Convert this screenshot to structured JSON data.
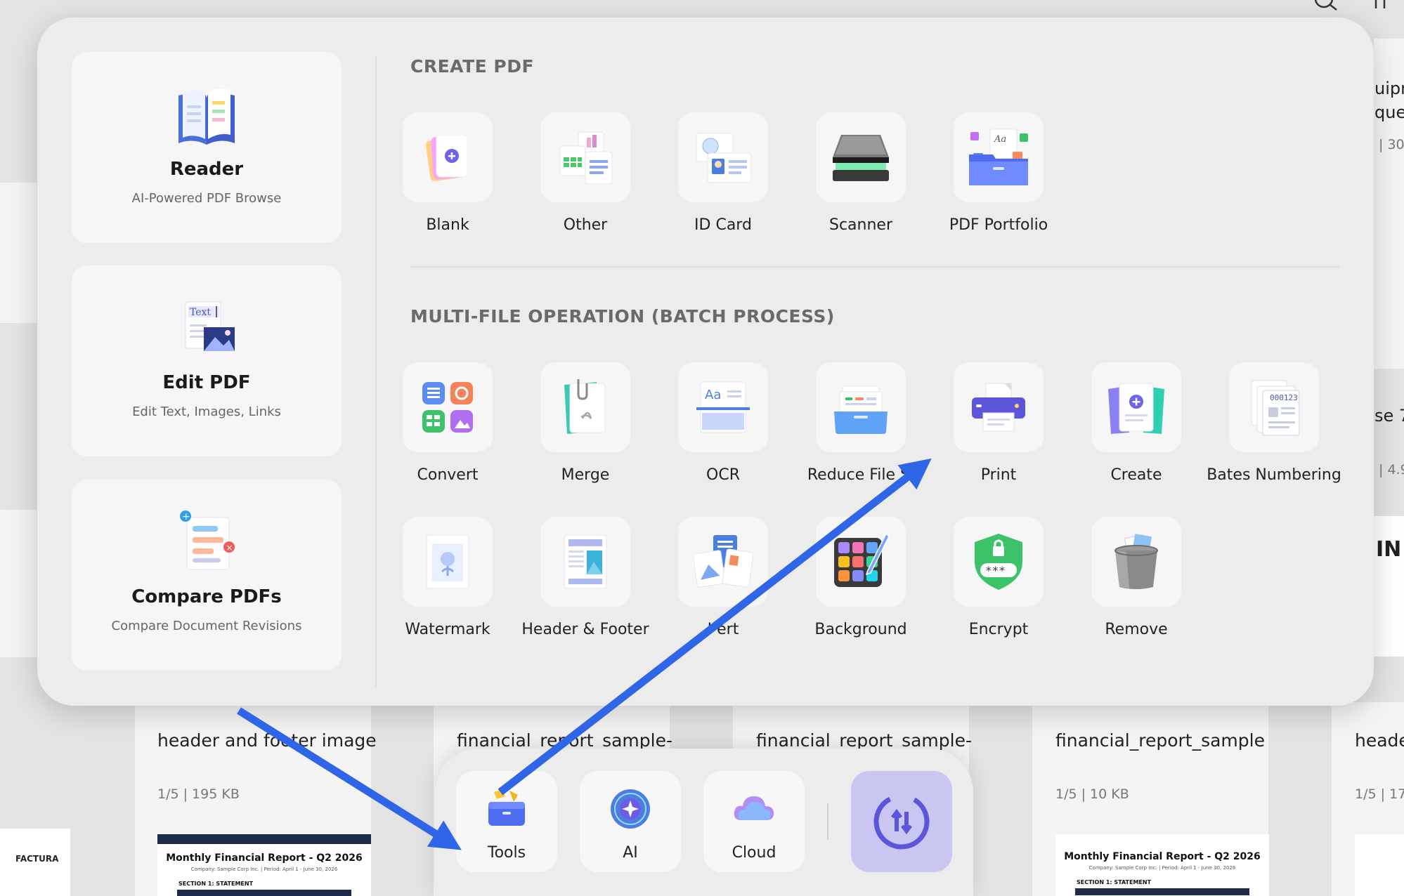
{
  "background_files": [
    {
      "title": "header and footer image",
      "meta": "1/5 | 195 KB",
      "thumb_title": "Monthly Financial Report - Q2 2026",
      "thumb_sub": "Company: Sample Corp Inc. | Period: April 1 - June 30, 2026",
      "thumb_section": "SECTION 1:  STATEMENT"
    },
    {
      "title": "financial_report_sample-",
      "meta": "",
      "thumb_title": "",
      "thumb_sub": "",
      "thumb_section": ""
    },
    {
      "title": "financial_report_sample-",
      "meta": "",
      "thumb_title": "",
      "thumb_sub": "",
      "thumb_section": ""
    },
    {
      "title": "financial_report_sample",
      "meta": "1/5 | 10 KB",
      "thumb_title": "Monthly Financial Report - Q2 2026",
      "thumb_sub": "Company: Sample Corp Inc. | Period: April 1 - June 30, 2026",
      "thumb_section": "SECTION 1:  STATEMENT"
    },
    {
      "title": "header",
      "meta": "1/5 | 17",
      "thumb_title": "",
      "thumb_sub": "",
      "thumb_section": ""
    }
  ],
  "edge_fragments": {
    "r1": "uipr",
    "r2": "que",
    "r3": "| 30",
    "r4": "se 7.",
    "r5": "| 4.9",
    "r6": "IN",
    "factura": "FACTURA"
  },
  "sidebar": [
    {
      "name": "Reader",
      "desc": "AI-Powered PDF Browse",
      "icon": "book-icon"
    },
    {
      "name": "Edit PDF",
      "desc": "Edit Text, Images, Links",
      "icon": "edit-text-image-icon"
    },
    {
      "name": "Compare PDFs",
      "desc": "Compare Document Revisions",
      "icon": "compare-icon"
    }
  ],
  "create_pdf": {
    "title": "CREATE PDF",
    "items": [
      {
        "label": "Blank",
        "icon": "blank-page-icon"
      },
      {
        "label": "Other",
        "icon": "other-files-icon"
      },
      {
        "label": "ID Card",
        "icon": "id-card-icon"
      },
      {
        "label": "Scanner",
        "icon": "scanner-icon"
      },
      {
        "label": "PDF Portfolio",
        "icon": "portfolio-icon"
      }
    ]
  },
  "batch": {
    "title": "MULTI-FILE OPERATION (BATCH PROCESS)",
    "items": [
      {
        "label": "Convert",
        "icon": "convert-icon"
      },
      {
        "label": "Merge",
        "icon": "merge-icon"
      },
      {
        "label": "OCR",
        "icon": "ocr-icon"
      },
      {
        "label": "Reduce File Si",
        "icon": "reduce-file-size-icon"
      },
      {
        "label": "Print",
        "icon": "printer-icon"
      },
      {
        "label": "Create",
        "icon": "create-icon"
      },
      {
        "label": "Bates Numbering",
        "icon": "bates-numbering-icon"
      },
      {
        "label": "Watermark",
        "icon": "watermark-icon"
      },
      {
        "label": "Header & Footer",
        "icon": "header-footer-icon"
      },
      {
        "label": "I   ert",
        "icon": "insert-icon"
      },
      {
        "label": "Background",
        "icon": "background-icon"
      },
      {
        "label": "Encrypt",
        "icon": "encrypt-shield-icon"
      },
      {
        "label": "Remove",
        "icon": "trash-icon"
      }
    ]
  },
  "dock": {
    "tools": "Tools",
    "ai": "AI",
    "cloud": "Cloud"
  },
  "colors": {
    "annotation_arrow": "#2f66e8",
    "accent_purple": "#5d55d9",
    "sync_tile": "#c9c7f2"
  }
}
